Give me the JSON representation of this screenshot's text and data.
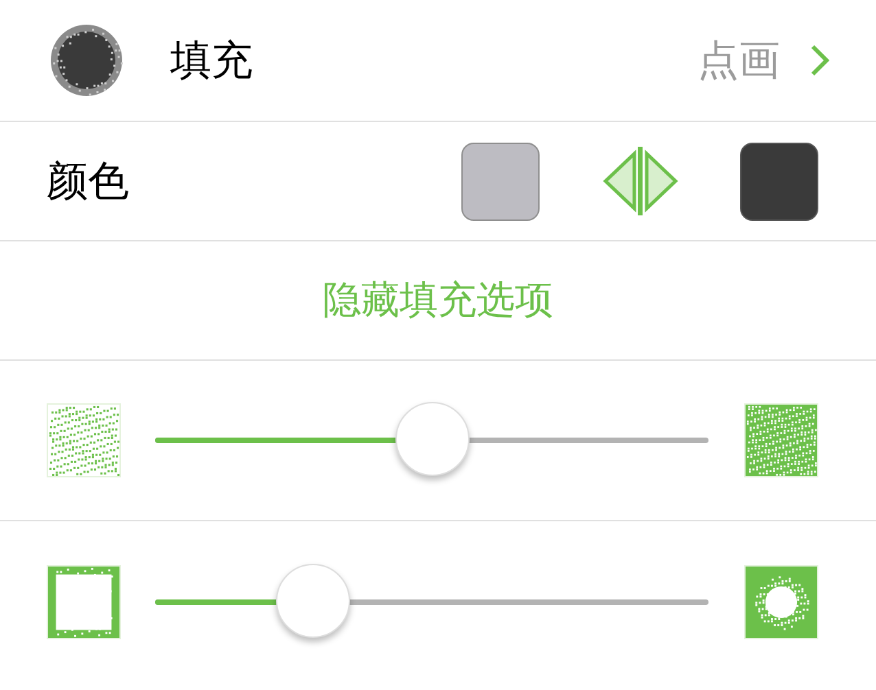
{
  "fill": {
    "label": "填充",
    "value": "点画"
  },
  "color": {
    "label": "颜色",
    "swatches": [
      {
        "color": "#bdbcc2"
      },
      {
        "color": "#3a3a3a"
      }
    ]
  },
  "toggle_options": {
    "label": "隐藏填充选项"
  },
  "sliders": [
    {
      "level": 0.5
    },
    {
      "level": 0.286
    }
  ]
}
